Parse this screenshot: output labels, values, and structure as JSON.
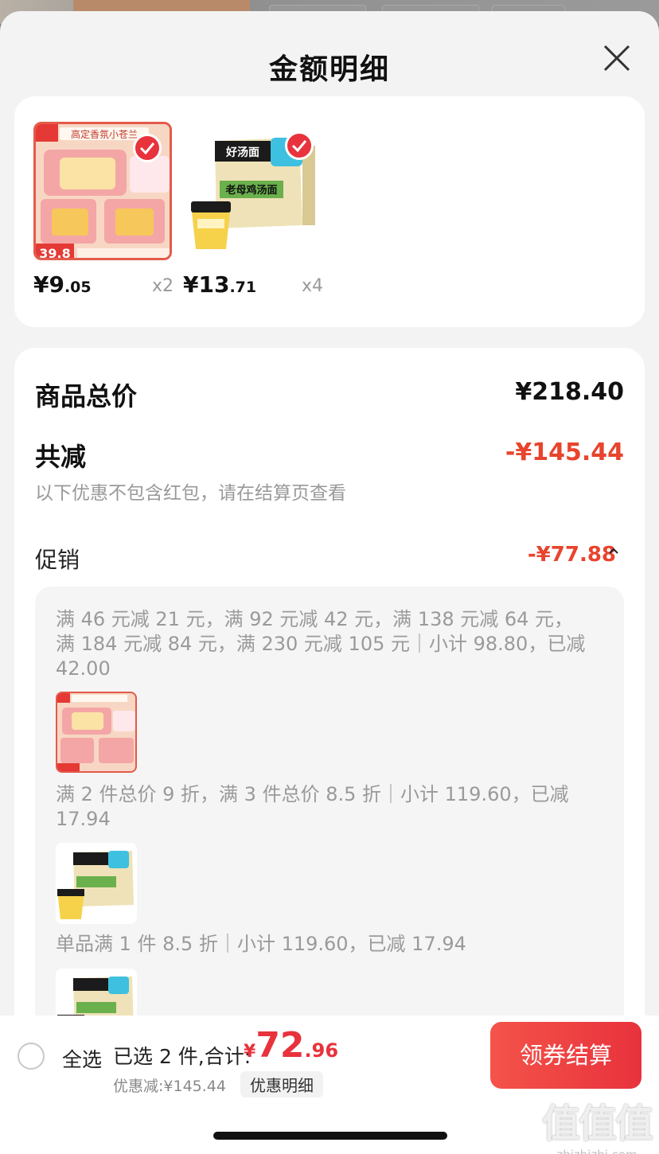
{
  "sheet": {
    "title": "金额明细"
  },
  "products": [
    {
      "price_int": "¥9",
      "price_dec": ".05",
      "qty": "x2",
      "thumb_text": "高定香氛小苍兰",
      "badge": "39.8"
    },
    {
      "price_int": "¥13",
      "price_dec": ".71",
      "qty": "x4",
      "thumb_text": "老母鸡汤面",
      "brand": "好汤面"
    }
  ],
  "summary": {
    "goods_total_label": "商品总价",
    "goods_total_value": "¥218.40",
    "reduce_label": "共减",
    "reduce_value": "-¥145.44",
    "note": "以下优惠不包含红包，请在结算页查看",
    "promo_label": "促销",
    "promo_value": "-¥77.88"
  },
  "promos": [
    {
      "text": "满 46 元减 21 元，满 92 元减 42 元，满 138 元减 64 元，满 184 元减 84 元，满 230 元减 105 元｜小计 98.80，已减 42.00"
    },
    {
      "text": "满 2 件总价 9 折，满 3 件总价 8.5 折｜小计 119.60，已减 17.94"
    },
    {
      "text": "单品满 1 件 8.5 折｜小计 119.60，已减 17.94"
    }
  ],
  "bottom": {
    "select_all": "全选",
    "selected_info": "已选 2 件,合计:",
    "total_symbol": "¥",
    "total_int": "72",
    "total_dec": ".96",
    "discount_info": "优惠减:¥145.44",
    "discount_detail": "优惠明细",
    "checkout": "领券结算"
  },
  "watermark": {
    "glyphs": "值值值",
    "domain": "zhizhizhi.com"
  },
  "colors": {
    "accent": "#e8323c",
    "discount": "#e8442e"
  }
}
